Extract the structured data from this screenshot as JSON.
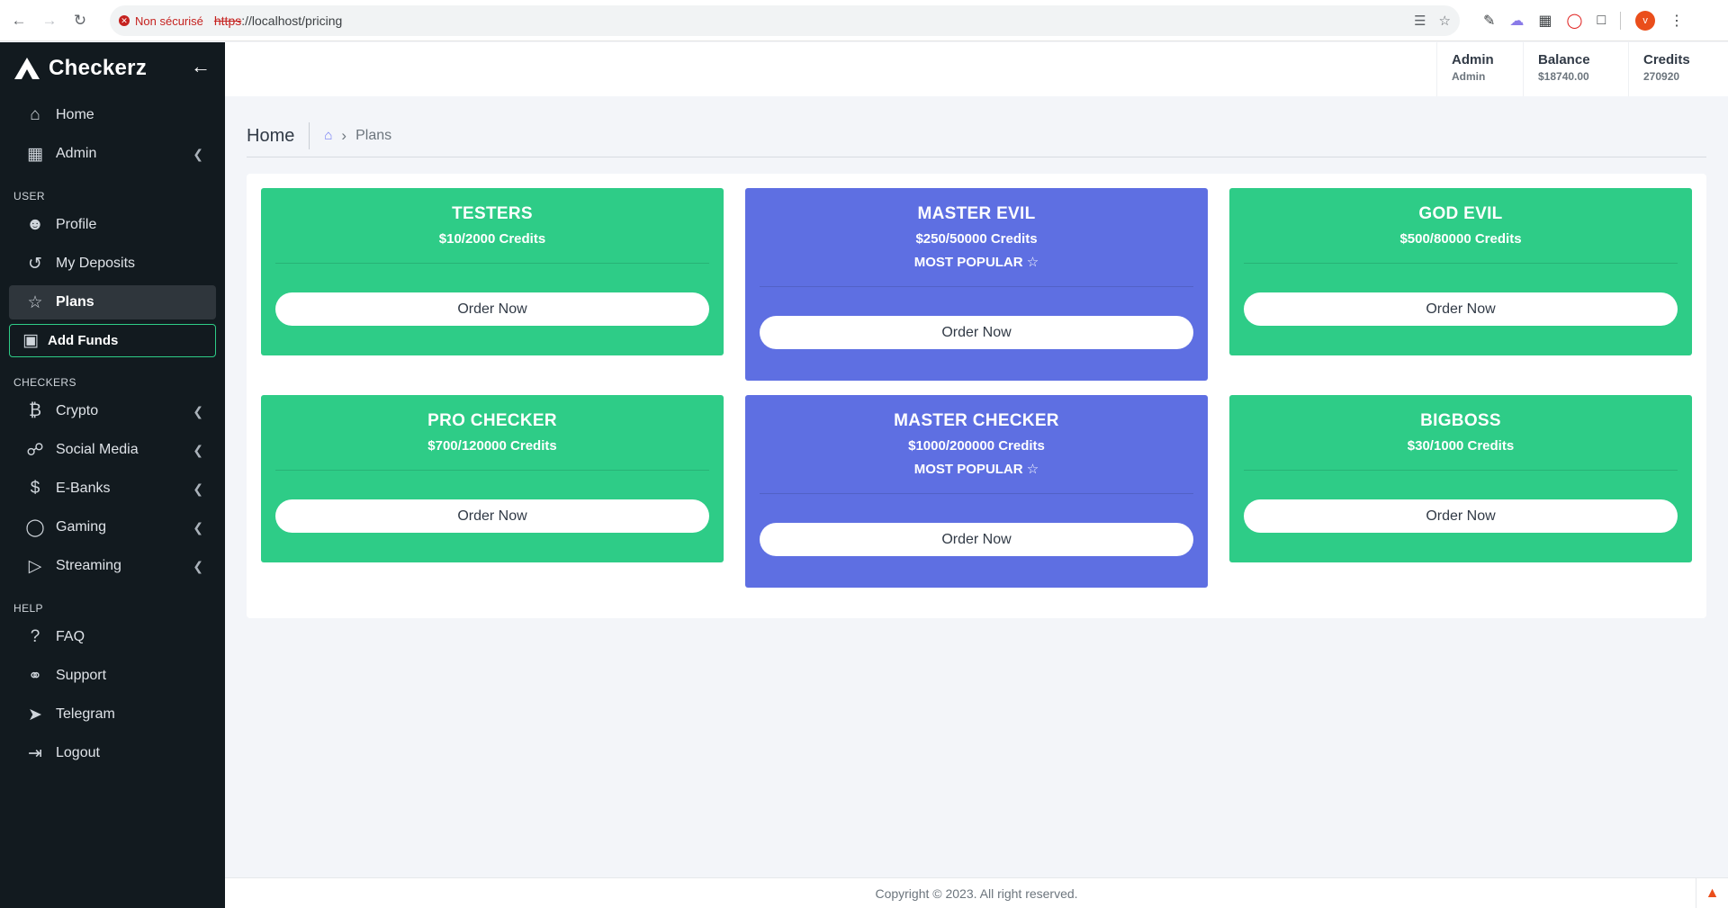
{
  "browser": {
    "security_label": "Non sécurisé",
    "url_scheme": "https",
    "url_rest": "://localhost/pricing",
    "profile_initial": "v"
  },
  "sidebar": {
    "brand": "Checkerz",
    "items_top": [
      {
        "label": "Home",
        "icon": "home-icon"
      },
      {
        "label": "Admin",
        "icon": "grid-icon"
      }
    ],
    "section_user": "USER",
    "items_user": [
      {
        "label": "Profile",
        "icon": "user-icon"
      },
      {
        "label": "My Deposits",
        "icon": "history-icon"
      },
      {
        "label": "Plans",
        "icon": "star-icon"
      },
      {
        "label": "Add Funds",
        "icon": "wallet-icon"
      }
    ],
    "section_checkers": "CHECKERS",
    "items_checkers": [
      {
        "label": "Crypto",
        "icon": "bitcoin-icon"
      },
      {
        "label": "Social Media",
        "icon": "share-icon"
      },
      {
        "label": "E-Banks",
        "icon": "dollar-icon"
      },
      {
        "label": "Gaming",
        "icon": "gaming-icon"
      },
      {
        "label": "Streaming",
        "icon": "video-icon"
      }
    ],
    "section_help": "HELP",
    "items_help": [
      {
        "label": "FAQ",
        "icon": "question-icon"
      },
      {
        "label": "Support",
        "icon": "headset-icon"
      },
      {
        "label": "Telegram",
        "icon": "send-icon"
      },
      {
        "label": "Logout",
        "icon": "logout-icon"
      }
    ]
  },
  "topbar": {
    "user_name": "Admin",
    "user_role": "Admin",
    "balance_label": "Balance",
    "balance_value": "$18740.00",
    "credits_label": "Credits",
    "credits_value": "270920"
  },
  "page": {
    "title": "Home",
    "breadcrumb": "Plans"
  },
  "plans": [
    {
      "name": "TESTERS",
      "price": "$10/2000 Credits",
      "tag": "",
      "button": "Order Now",
      "color": "#2ecc87"
    },
    {
      "name": "MASTER EVIL",
      "price": "$250/50000 Credits",
      "tag": "MOST POPULAR ☆",
      "button": "Order Now",
      "color": "#5e6fe2"
    },
    {
      "name": "GOD EVIL",
      "price": "$500/80000 Credits",
      "tag": "",
      "button": "Order Now",
      "color": "#2ecc87"
    },
    {
      "name": "PRO CHECKER",
      "price": "$700/120000 Credits",
      "tag": "",
      "button": "Order Now",
      "color": "#2ecc87"
    },
    {
      "name": "MASTER CHECKER",
      "price": "$1000/200000 Credits",
      "tag": "MOST POPULAR ☆",
      "button": "Order Now",
      "color": "#5e6fe2"
    },
    {
      "name": "BIGBOSS",
      "price": "$30/1000 Credits",
      "tag": "",
      "button": "Order Now",
      "color": "#2ecc87"
    }
  ],
  "footer": {
    "copyright": "Copyright © 2023. All right reserved."
  }
}
